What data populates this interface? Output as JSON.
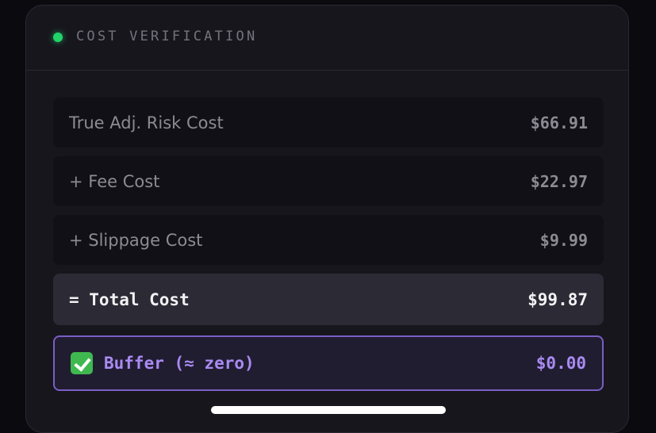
{
  "header": {
    "title": "COST VERIFICATION",
    "status_color": "#22d36b"
  },
  "rows": [
    {
      "label": "True Adj. Risk Cost",
      "value": "$66.91"
    },
    {
      "label": "+ Fee Cost",
      "value": "$22.97"
    },
    {
      "label": "+ Slippage Cost",
      "value": "$9.99"
    }
  ],
  "total": {
    "label": "= Total Cost",
    "value": "$99.87"
  },
  "buffer": {
    "icon": "check-icon",
    "label": "Buffer (≈ zero)",
    "value": "$0.00",
    "accent_color": "#a98bf2"
  }
}
